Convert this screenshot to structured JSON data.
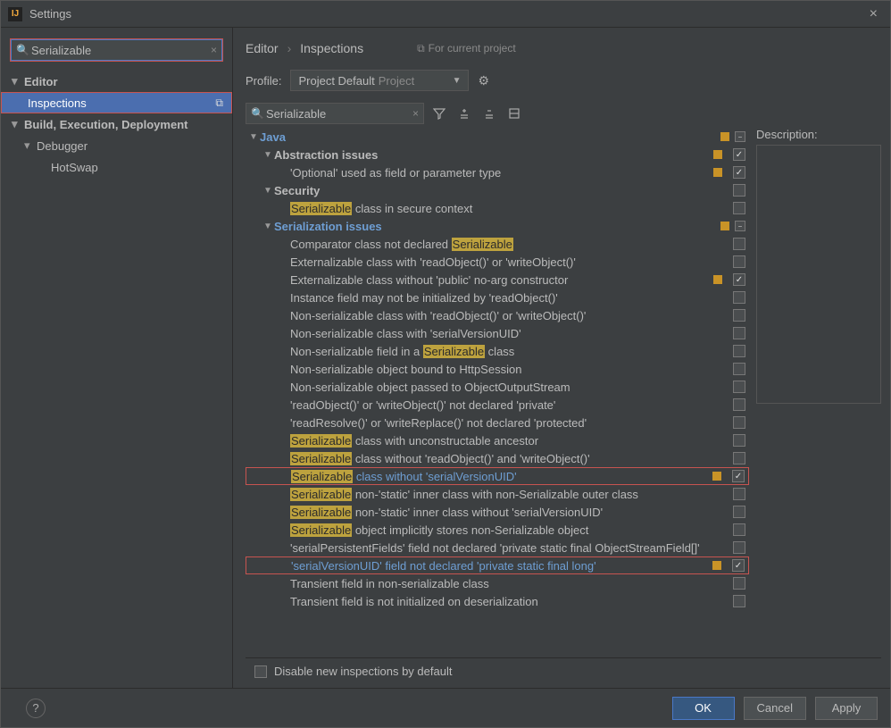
{
  "window": {
    "title": "Settings"
  },
  "sidebar": {
    "search": {
      "value": "Serializable"
    },
    "nodes": [
      {
        "label": "Editor",
        "bold": true
      },
      {
        "label": "Inspections",
        "selected": true
      },
      {
        "label": "Build, Execution, Deployment",
        "bold": true
      },
      {
        "label": "Debugger"
      },
      {
        "label": "HotSwap"
      }
    ]
  },
  "breadcrumb": {
    "a": "Editor",
    "b": "Inspections",
    "note": "For current project"
  },
  "profile": {
    "label": "Profile:",
    "name": "Project Default",
    "tag": "Project"
  },
  "toolbar_search": {
    "value": "Serializable"
  },
  "tree": {
    "root": "Java",
    "abstraction": {
      "label": "Abstraction issues",
      "items": [
        "'Optional' used as field or parameter type"
      ]
    },
    "security": {
      "label": "Security",
      "items": [
        {
          "pre": "Serializable",
          "post": " class in secure context"
        }
      ]
    },
    "serialization": {
      "label": "Serialization issues",
      "items": [
        {
          "pre": "Comparator class not declared ",
          "hl": "Serializable",
          "post": ""
        },
        {
          "plain": "Externalizable class with 'readObject()' or 'writeObject()'"
        },
        {
          "plain": "Externalizable class without 'public' no-arg constructor",
          "checked": true,
          "orange": true
        },
        {
          "plain": "Instance field may not be initialized by 'readObject()'"
        },
        {
          "plain": "Non-serializable class with 'readObject()' or 'writeObject()'"
        },
        {
          "plain": "Non-serializable class with 'serialVersionUID'"
        },
        {
          "pre": "Non-serializable field in a ",
          "hl": "Serializable",
          "post": " class"
        },
        {
          "plain": "Non-serializable object bound to HttpSession"
        },
        {
          "plain": "Non-serializable object passed to ObjectOutputStream"
        },
        {
          "plain": "'readObject()' or 'writeObject()' not declared 'private'"
        },
        {
          "plain": "'readResolve()' or 'writeReplace()' not declared 'protected'"
        },
        {
          "hl": "Serializable",
          "post": " class with unconstructable ancestor"
        },
        {
          "hl": "Serializable",
          "post": " class without 'readObject()' and 'writeObject()'"
        },
        {
          "hl": "Serializable",
          "post": " class without 'serialVersionUID'",
          "link": true,
          "checked": true,
          "orange": true,
          "redbox": true
        },
        {
          "hl": "Serializable",
          "post": " non-'static' inner class with non-Serializable outer class"
        },
        {
          "hl": "Serializable",
          "post": " non-'static' inner class without 'serialVersionUID'"
        },
        {
          "hl": "Serializable",
          "post": " object implicitly stores non-Serializable object"
        },
        {
          "plain": "'serialPersistentFields' field not declared 'private static final ObjectStreamField[]'"
        },
        {
          "plain": "'serialVersionUID' field not declared 'private static final long'",
          "link": true,
          "checked": true,
          "orange": true,
          "redbox": true
        },
        {
          "plain": "Transient field in non-serializable class"
        },
        {
          "plain": "Transient field is not initialized on deserialization"
        }
      ]
    }
  },
  "description": {
    "label": "Description:"
  },
  "footer": {
    "disable_label": "Disable new inspections by default"
  },
  "buttons": {
    "ok": "OK",
    "cancel": "Cancel",
    "apply": "Apply"
  }
}
